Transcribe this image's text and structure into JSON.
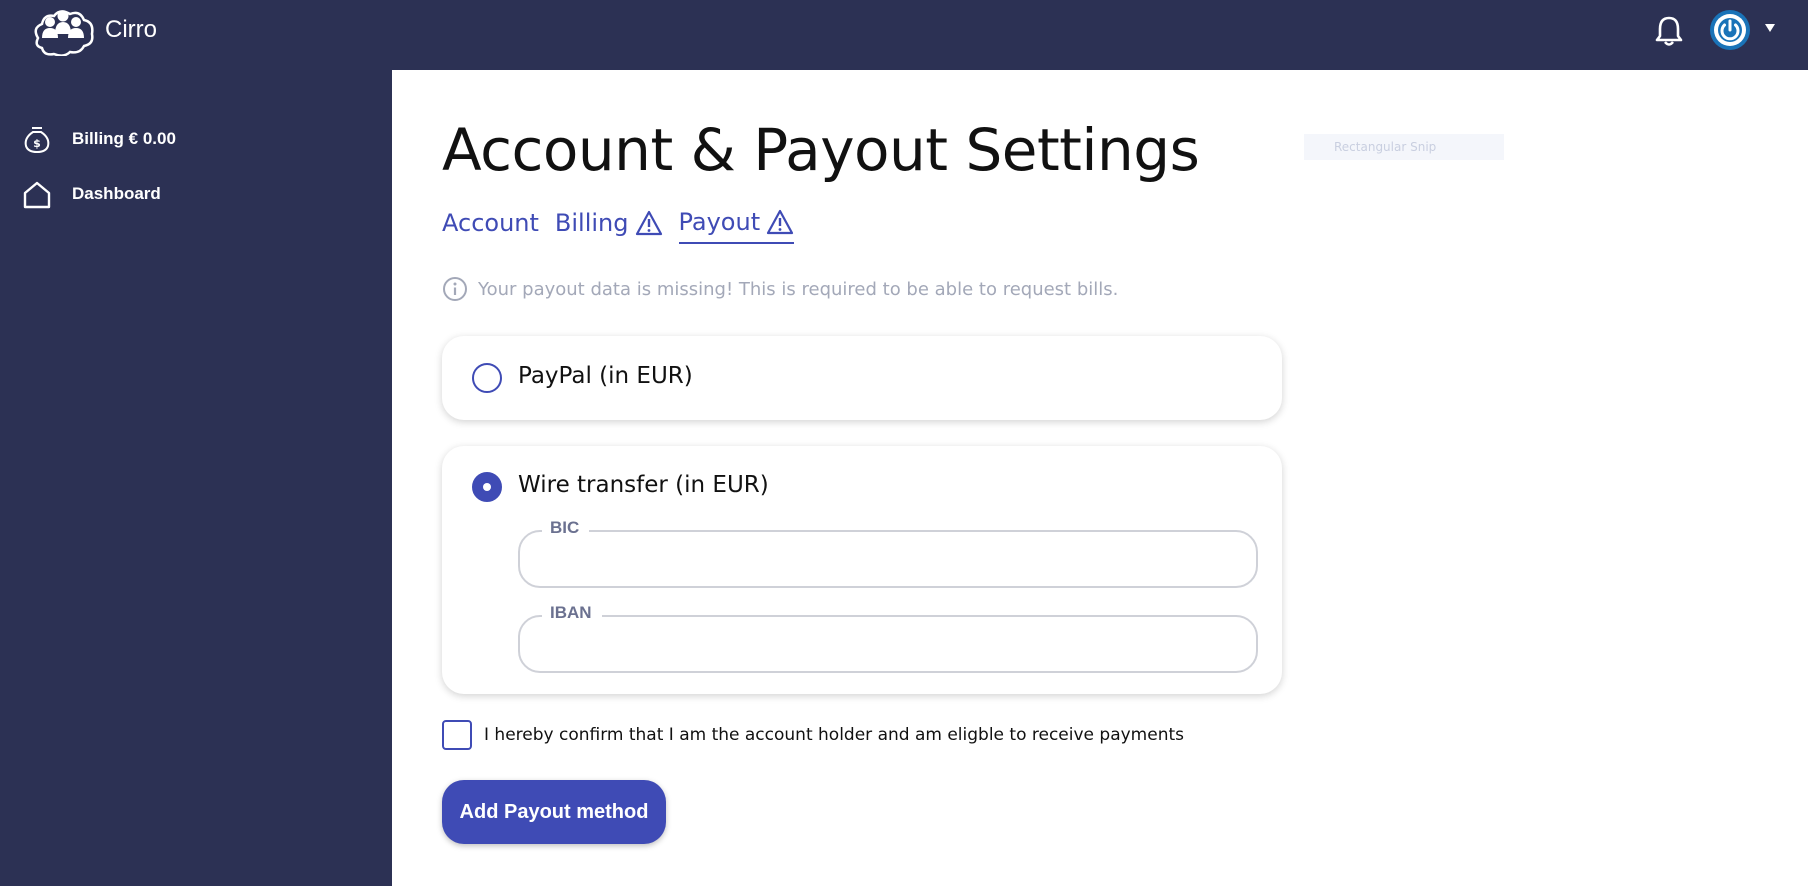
{
  "app": {
    "brand": "Cirro"
  },
  "header": {
    "bell_icon": "bell-icon",
    "avatar_icon": "power-icon",
    "menu_icon": "caret-down-icon"
  },
  "sidebar": {
    "items": [
      {
        "label": "Billing € 0.00",
        "icon": "money-bag-icon"
      },
      {
        "label": "Dashboard",
        "icon": "home-icon"
      }
    ]
  },
  "page": {
    "title": "Account & Payout Settings",
    "ghost_overlay": "Rectangular Snip"
  },
  "tabs": [
    {
      "label": "Account",
      "warning": false,
      "active": false
    },
    {
      "label": "Billing",
      "warning": true,
      "active": false
    },
    {
      "label": "Payout",
      "warning": true,
      "active": true
    }
  ],
  "notice": {
    "text": "Your payout data is missing! This is required to be able to request bills.",
    "icon": "info-icon"
  },
  "payout_options": [
    {
      "label": "PayPal (in EUR)",
      "selected": false
    },
    {
      "label": "Wire transfer (in EUR)",
      "selected": true
    }
  ],
  "wire_fields": {
    "bic": {
      "label": "BIC",
      "value": ""
    },
    "iban": {
      "label": "IBAN",
      "value": ""
    }
  },
  "confirm": {
    "text": "I hereby confirm that I am the account holder and am eligble to receive payments",
    "checked": false
  },
  "button": {
    "label": "Add Payout method"
  },
  "colors": {
    "navy": "#2c3154",
    "accent": "#3f4bb5",
    "avatar": "#1a73b8"
  }
}
